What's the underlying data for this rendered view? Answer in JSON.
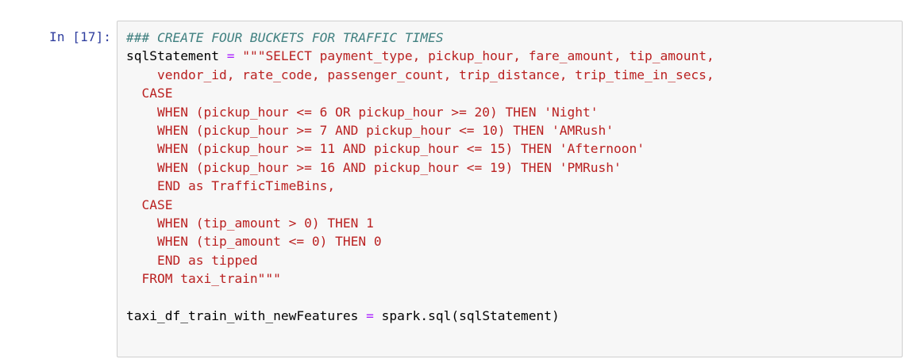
{
  "cell": {
    "prompt": "In [17]:",
    "lines": [
      [
        {
          "t": "### CREATE FOUR BUCKETS FOR TRAFFIC TIMES",
          "c": "comment"
        }
      ],
      [
        {
          "t": "sqlStatement ",
          "c": "plain"
        },
        {
          "t": "=",
          "c": "op"
        },
        {
          "t": " ",
          "c": "plain"
        },
        {
          "t": "\"\"\"SELECT payment_type, pickup_hour, fare_amount, tip_amount,",
          "c": "str"
        }
      ],
      [
        {
          "t": "    vendor_id, rate_code, passenger_count, trip_distance, trip_time_in_secs,",
          "c": "str"
        }
      ],
      [
        {
          "t": "  CASE",
          "c": "str"
        }
      ],
      [
        {
          "t": "    WHEN (pickup_hour <= 6 OR pickup_hour >= 20) THEN 'Night'",
          "c": "str"
        }
      ],
      [
        {
          "t": "    WHEN (pickup_hour >= 7 AND pickup_hour <= 10) THEN 'AMRush'",
          "c": "str"
        }
      ],
      [
        {
          "t": "    WHEN (pickup_hour >= 11 AND pickup_hour <= 15) THEN 'Afternoon'",
          "c": "str"
        }
      ],
      [
        {
          "t": "    WHEN (pickup_hour >= 16 AND pickup_hour <= 19) THEN 'PMRush'",
          "c": "str"
        }
      ],
      [
        {
          "t": "    END as TrafficTimeBins,",
          "c": "str"
        }
      ],
      [
        {
          "t": "  CASE",
          "c": "str"
        }
      ],
      [
        {
          "t": "    WHEN (tip_amount > 0) THEN 1",
          "c": "str"
        }
      ],
      [
        {
          "t": "    WHEN (tip_amount <= 0) THEN 0",
          "c": "str"
        }
      ],
      [
        {
          "t": "    END as tipped",
          "c": "str"
        }
      ],
      [
        {
          "t": "  FROM taxi_train\"\"\"",
          "c": "str"
        }
      ],
      [
        {
          "t": "",
          "c": "plain"
        }
      ],
      [
        {
          "t": "taxi_df_train_with_newFeatures ",
          "c": "plain"
        },
        {
          "t": "=",
          "c": "op"
        },
        {
          "t": " spark.sql(sqlStatement)",
          "c": "plain"
        }
      ]
    ]
  }
}
